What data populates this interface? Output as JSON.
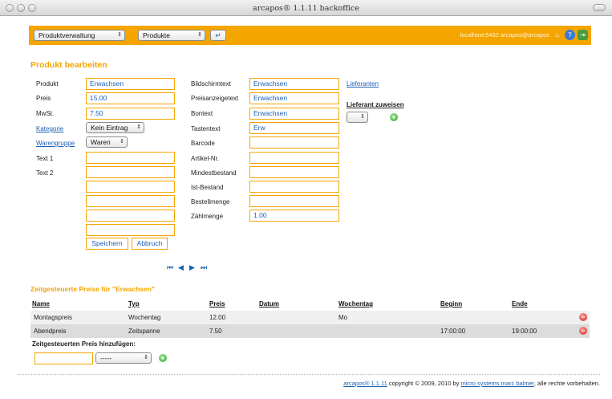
{
  "window": {
    "title": "arcapos® 1.1.11 backoffice"
  },
  "toolbar": {
    "module_select": "Produktverwaltung",
    "view_select": "Produkte",
    "enter_label": "↵",
    "status": "localhost:5432 arcapos@arcapos"
  },
  "form": {
    "title": "Produkt bearbeiten",
    "left": {
      "produkt_label": "Produkt",
      "produkt_value": "Erwachsen",
      "preis_label": "Preis",
      "preis_value": "15.00",
      "mwst_label": "MwSt.",
      "mwst_value": "7.50",
      "kategorie_label": "Kategorie",
      "kategorie_value": "Kein Eintrag",
      "warengruppe_label": "Warengruppe",
      "warengruppe_value": "Waren",
      "text1_label": "Text 1",
      "text2_label": "Text 2"
    },
    "middle": {
      "bildschirmtext_label": "Bildschirmtext",
      "bildschirmtext_value": "Erwachsen",
      "preisanzeigetext_label": "Preisanzeigetext",
      "preisanzeigetext_value": "Erwachsen",
      "bontext_label": "Bontext",
      "bontext_value": "Erwachsen",
      "tastentext_label": "Tastentext",
      "tastentext_value": "Erw",
      "barcode_label": "Barcode",
      "artikelnr_label": "Artikel-Nr.",
      "mindestbestand_label": "Mindestbestand",
      "istbestand_label": "Ist-Bestand",
      "bestellmenge_label": "Bestellmenge",
      "zaehlmenge_label": "Zählmenge",
      "zaehlmenge_value": "1.00"
    },
    "right": {
      "lieferanten_link": "Lieferanten",
      "lieferant_zuweisen": "Lieferant zuweisen"
    },
    "save_label": "Speichern",
    "cancel_label": "Abbruch"
  },
  "pager": {
    "first": "⏮",
    "prev": "◀",
    "next": "▶",
    "last": "⏭"
  },
  "timed_prices": {
    "title": "Zeitgesteuerte Preise für \"Erwachsen\"",
    "columns": [
      "Name",
      "Typ",
      "Preis",
      "Datum",
      "Wochentag",
      "Beginn",
      "Ende"
    ],
    "rows": [
      {
        "name": "Montagspreis",
        "typ": "Wochentag",
        "preis": "12.00",
        "datum": "",
        "wochentag": "Mo",
        "beginn": "",
        "ende": ""
      },
      {
        "name": "Abendpreis",
        "typ": "Zeitspanne",
        "preis": "7.50",
        "datum": "",
        "wochentag": "",
        "beginn": "17:00:00",
        "ende": "19:00:00"
      }
    ],
    "add_label": "Zeitgesteuerten Preis hinzufügen:",
    "add_select": "-----"
  },
  "footer": {
    "product_link": "arcapos® 1.1.11",
    "copyright": " copyright © 2009, 2010 by ",
    "company_link": "micro systems marc balmer",
    "rights": ", alle rechte vorbehalten."
  },
  "colors": {
    "accent": "#f5a500",
    "link": "#1a5fb4",
    "row_a": "#f0f0f0",
    "row_b": "#dcdcdc"
  }
}
